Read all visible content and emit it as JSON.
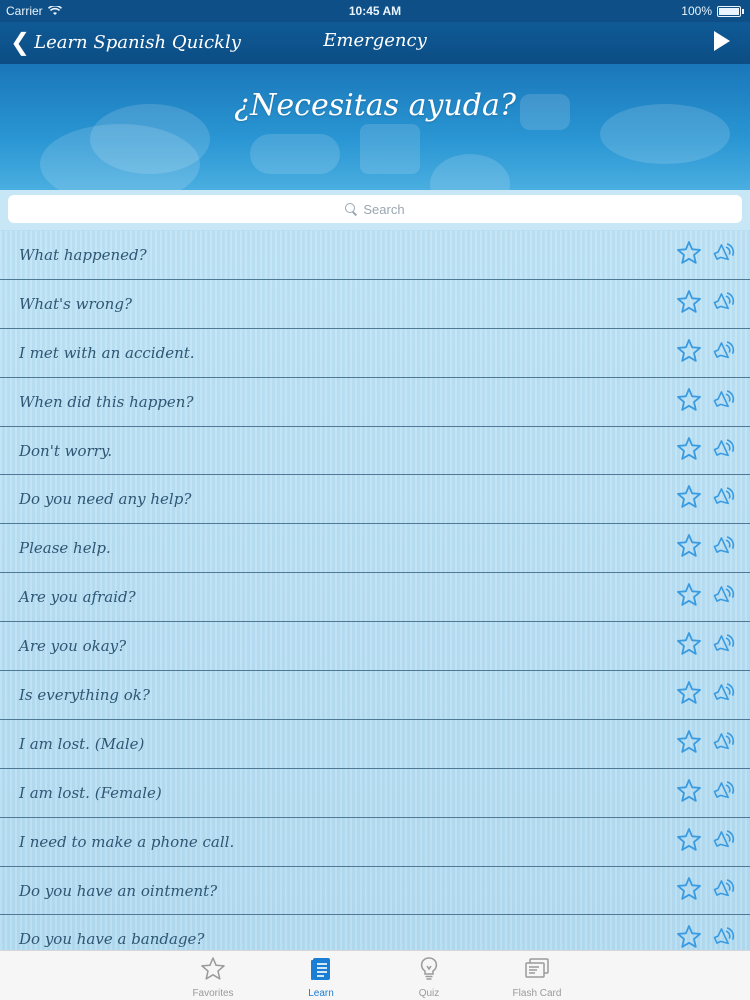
{
  "status_bar": {
    "carrier": "Carrier",
    "time": "10:45 AM",
    "battery": "100%"
  },
  "nav": {
    "back_label": "Learn Spanish Quickly",
    "title": "Emergency"
  },
  "banner": {
    "title": "¿Necesitas ayuda?"
  },
  "search": {
    "placeholder": "Search"
  },
  "phrases": [
    "What happened?",
    "What's wrong?",
    "I met with an accident.",
    "When did this happen?",
    "Don't worry.",
    "Do you need any help?",
    "Please help.",
    "Are you afraid?",
    "Are you okay?",
    "Is everything ok?",
    "I am lost. (Male)",
    "I am lost. (Female)",
    "I need to make a phone call.",
    "Do you have an ointment?",
    "Do you have a bandage?"
  ],
  "tabs": [
    {
      "label": "Favorites",
      "icon": "star-icon"
    },
    {
      "label": "Learn",
      "icon": "book-icon",
      "active": true
    },
    {
      "label": "Quiz",
      "icon": "lightbulb-icon"
    },
    {
      "label": "Flash Card",
      "icon": "flash-card-icon"
    }
  ],
  "colors": {
    "nav_bg": "#0d4f86",
    "accent": "#1a7fd4",
    "icon_blue": "#3a9be0",
    "phrase_text": "#2f5673"
  }
}
